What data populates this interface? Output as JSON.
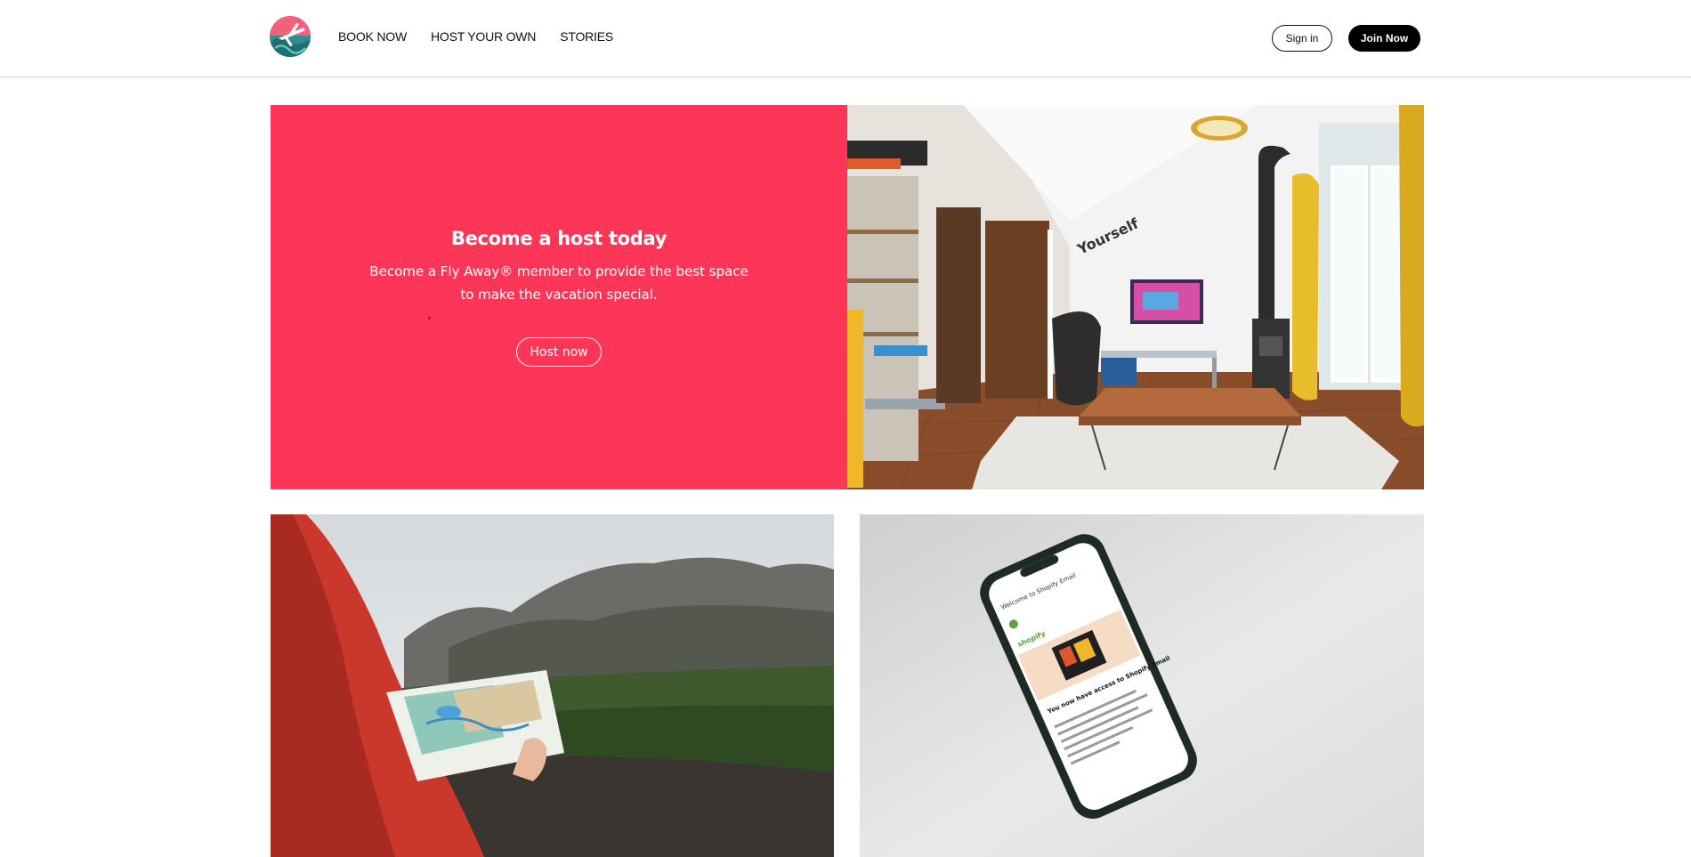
{
  "header": {
    "logo": "fly-away-plane-logo",
    "nav": [
      "BOOK NOW",
      "HOST YOUR OWN",
      "STORIES"
    ],
    "sign_in_label": "Sign in",
    "join_label": "Join Now"
  },
  "hero": {
    "title": "Become a host today",
    "text": "Become a Fly Away® member to provide the best space to make the vacation special.",
    "button_label": "Host now",
    "panel_color": "#fd3557",
    "image": "living-room-photo"
  },
  "photos": {
    "left": "hiker-holding-map-photo",
    "right": "smartphone-shopify-email-photo"
  },
  "phone_screen": {
    "heading": "Welcome to Shopify Email",
    "brand": "shopify",
    "title": "You now have access to Shopify Email"
  },
  "room_wall_text": "Yourself"
}
